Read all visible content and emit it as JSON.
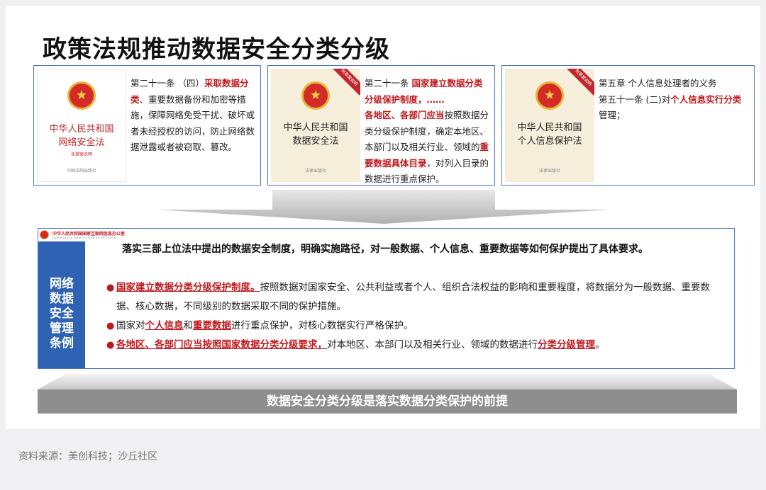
{
  "title": "政策法规推动数据安全分类分级",
  "laws": [
    {
      "cover_title_1": "中华人民共和国",
      "cover_title_2": "网络安全法",
      "cover_sub": "含草案说明",
      "cover_pub": "中国法制出版社",
      "t1": "第二十一条 （四）",
      "t2": "采取数据分类",
      "t3": "、重要数据备份和加密等措施，保障网络免受干扰、破坏或者未经授权的访问，防止网络数据泄露或者被窃取、篡改。"
    },
    {
      "ribbon": "附草案说明",
      "cover_title_1": "中华人民共和国",
      "cover_title_2": "数据安全法",
      "cover_pub": "法律出版社",
      "t1": "第二十一条 ",
      "t2": "国家建立数据分类分级保护制度，……",
      "t3": "各地区、各部门应当",
      "t4": "按照数据分类分级保护制度，确定本地区、本部门以及相关行业、领域的",
      "t5": "重要数据具体目录",
      "t6": "，对列入目录的数据进行重点保护。"
    },
    {
      "ribbon": "附草案说明",
      "cover_title_1": "中华人民共和国",
      "cover_title_2": "个人信息保护法",
      "cover_pub": "法律出版社",
      "t1": "第五章 个人信息处理者的义务",
      "t2": "第五十一条 (二)对",
      "t3": "个人信息实行分类",
      "t4": "管理；"
    }
  ],
  "regulation": {
    "agency_name": "中华人民共和国国家互联网信息办公室",
    "agency_en": "Cyberspace Administration of China",
    "side_label": [
      "网络",
      "数据",
      "安全",
      "管理",
      "条例"
    ],
    "intro": "落实三部上位法中提出的数据安全制度，明确实施路径，对一般数据、个人信息、重要数据等如何保护提出了具体要求。",
    "bullet_glyph": "●",
    "b1_red": "国家建立数据分类分级保护制度。",
    "b1_text": "按照数据对国家安全、公共利益或者个人、组织合法权益的影响和重要程度，将数据分为一般数据、重要数据、核心数据，不同级别的数据采取不同的保护措施。",
    "b2_a": "国家对",
    "b2_red1": "个人信息",
    "b2_b": "和",
    "b2_red2": "重要数据",
    "b2_c": "进行重点保护，对核心数据实行严格保护。",
    "b3_red": "各地区、各部门应当按照国家数据分类分级要求，",
    "b3_text": "对本地区、本部门以及相关行业、领域的数据进行",
    "b3_red2": "分类分级管理",
    "b3_end": "。"
  },
  "bottom_bar": "数据安全分类分级是落实数据分类保护的前提",
  "source": "资料来源：美创科技；沙丘社区",
  "colors": {
    "accent_blue": "#2f62b2",
    "border_blue": "#4a76c4",
    "emphasis_red": "#c0171c",
    "bar_gray": "#8e8e8e"
  }
}
